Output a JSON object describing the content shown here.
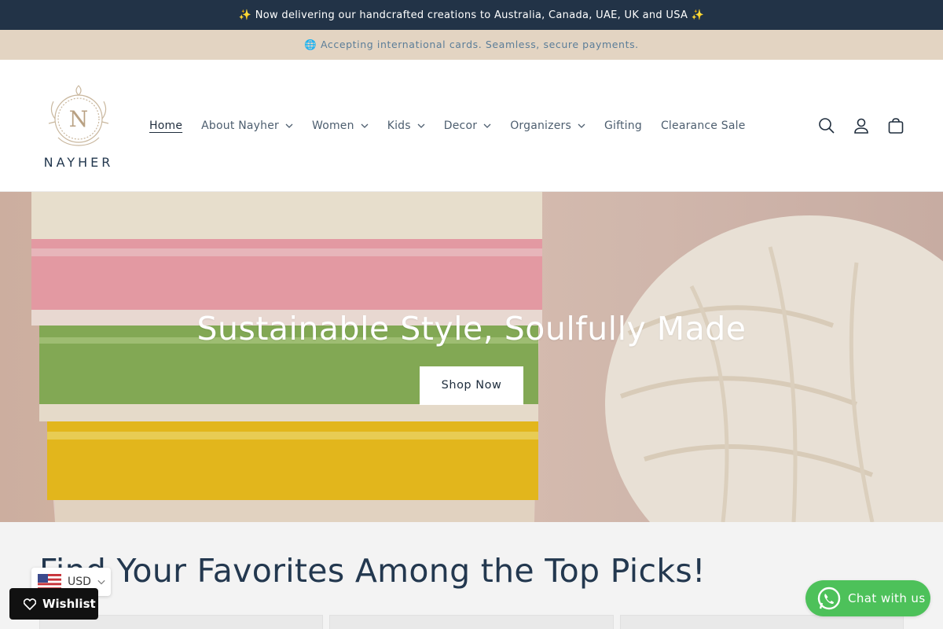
{
  "announcement": {
    "shipping": "✨ Now delivering our handcrafted creations to Australia, Canada, UAE, UK and USA ✨",
    "payments": "🌐 Accepting international cards. Seamless, secure payments."
  },
  "logo": {
    "text": "NAYHER",
    "monogram": "N"
  },
  "nav": {
    "items": [
      {
        "label": "Home",
        "active": true,
        "dropdown": false
      },
      {
        "label": "About Nayher",
        "dropdown": true
      },
      {
        "label": "Women",
        "dropdown": true
      },
      {
        "label": "Kids",
        "dropdown": true
      },
      {
        "label": "Decor",
        "dropdown": true
      },
      {
        "label": "Organizers",
        "dropdown": true
      },
      {
        "label": "Gifting",
        "dropdown": false
      },
      {
        "label": "Clearance Sale",
        "dropdown": false
      }
    ]
  },
  "header_icons": [
    "search-icon",
    "account-icon",
    "cart-icon"
  ],
  "hero": {
    "title": "Sustainable Style, Soulfully Made",
    "button": "Shop Now"
  },
  "picks": {
    "title": "Find Your Favorites Among the Top Picks!"
  },
  "widgets": {
    "currency": "USD",
    "wishlist": "Wishlist",
    "chat": "Chat with us"
  },
  "colors": {
    "announcement_bg": "#223347",
    "payments_bg": "#e3d4c2",
    "text_dark": "#23384f",
    "chat_green": "#4dc15a"
  }
}
